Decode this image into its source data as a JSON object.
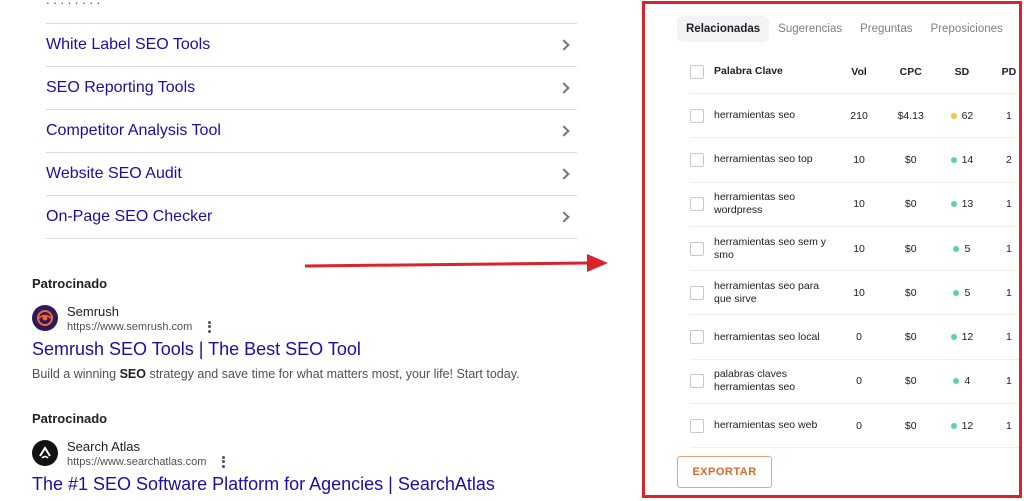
{
  "search_results": {
    "related_searches": [
      {
        "label": "White Label SEO Tools"
      },
      {
        "label": "SEO Reporting Tools"
      },
      {
        "label": "Competitor Analysis Tool"
      },
      {
        "label": "Website SEO Audit"
      },
      {
        "label": "On-Page SEO Checker"
      }
    ],
    "ads": [
      {
        "sponsored_label": "Patrocinado",
        "site_name": "Semrush",
        "url": "https://www.semrush.com",
        "title": "Semrush SEO Tools | The Best SEO Tool",
        "desc_before": "Build a winning ",
        "desc_bold": "SEO",
        "desc_after": " strategy and save time for what matters most, your life! Start today.",
        "icon": "semrush-logo-icon"
      },
      {
        "sponsored_label": "Patrocinado",
        "site_name": "Search Atlas",
        "url": "https://www.searchatlas.com",
        "title": "The #1 SEO Software Platform for Agencies | SearchAtlas",
        "icon": "searchatlas-logo-icon"
      }
    ]
  },
  "keyword_panel": {
    "tabs": [
      {
        "label": "Relacionadas",
        "active": true
      },
      {
        "label": "Sugerencias",
        "active": false
      },
      {
        "label": "Preguntas",
        "active": false
      },
      {
        "label": "Preposiciones",
        "active": false
      }
    ],
    "columns": {
      "keyword": "Palabra Clave",
      "vol": "Vol",
      "cpc": "CPC",
      "sd": "SD",
      "pd": "PD"
    },
    "rows": [
      {
        "keyword": "herramientas seo",
        "vol": "210",
        "cpc": "$4.13",
        "sd": "62",
        "sd_color": "#f4c542",
        "pd": "1"
      },
      {
        "keyword": "herramientas seo top",
        "vol": "10",
        "cpc": "$0",
        "sd": "14",
        "sd_color": "#5cd6a0",
        "pd": "2"
      },
      {
        "keyword": "herramientas seo wordpress",
        "vol": "10",
        "cpc": "$0",
        "sd": "13",
        "sd_color": "#5cd6a0",
        "pd": "1"
      },
      {
        "keyword": "herramientas seo sem y smo",
        "vol": "10",
        "cpc": "$0",
        "sd": "5",
        "sd_color": "#5cd6a0",
        "pd": "1"
      },
      {
        "keyword": "herramientas seo para que sirve",
        "vol": "10",
        "cpc": "$0",
        "sd": "5",
        "sd_color": "#5cd6a0",
        "pd": "1"
      },
      {
        "keyword": "herramientas seo local",
        "vol": "0",
        "cpc": "$0",
        "sd": "12",
        "sd_color": "#5cd6a0",
        "pd": "1"
      },
      {
        "keyword": "palabras claves herramientas seo",
        "vol": "0",
        "cpc": "$0",
        "sd": "4",
        "sd_color": "#5cd6a0",
        "pd": "1"
      },
      {
        "keyword": "herramientas seo web",
        "vol": "0",
        "cpc": "$0",
        "sd": "12",
        "sd_color": "#5cd6a0",
        "pd": "1"
      }
    ],
    "export_label": "EXPORTAR"
  },
  "colors": {
    "link": "#1a0dab",
    "annotation_red": "#d9242b",
    "export_orange": "#e0662d"
  }
}
